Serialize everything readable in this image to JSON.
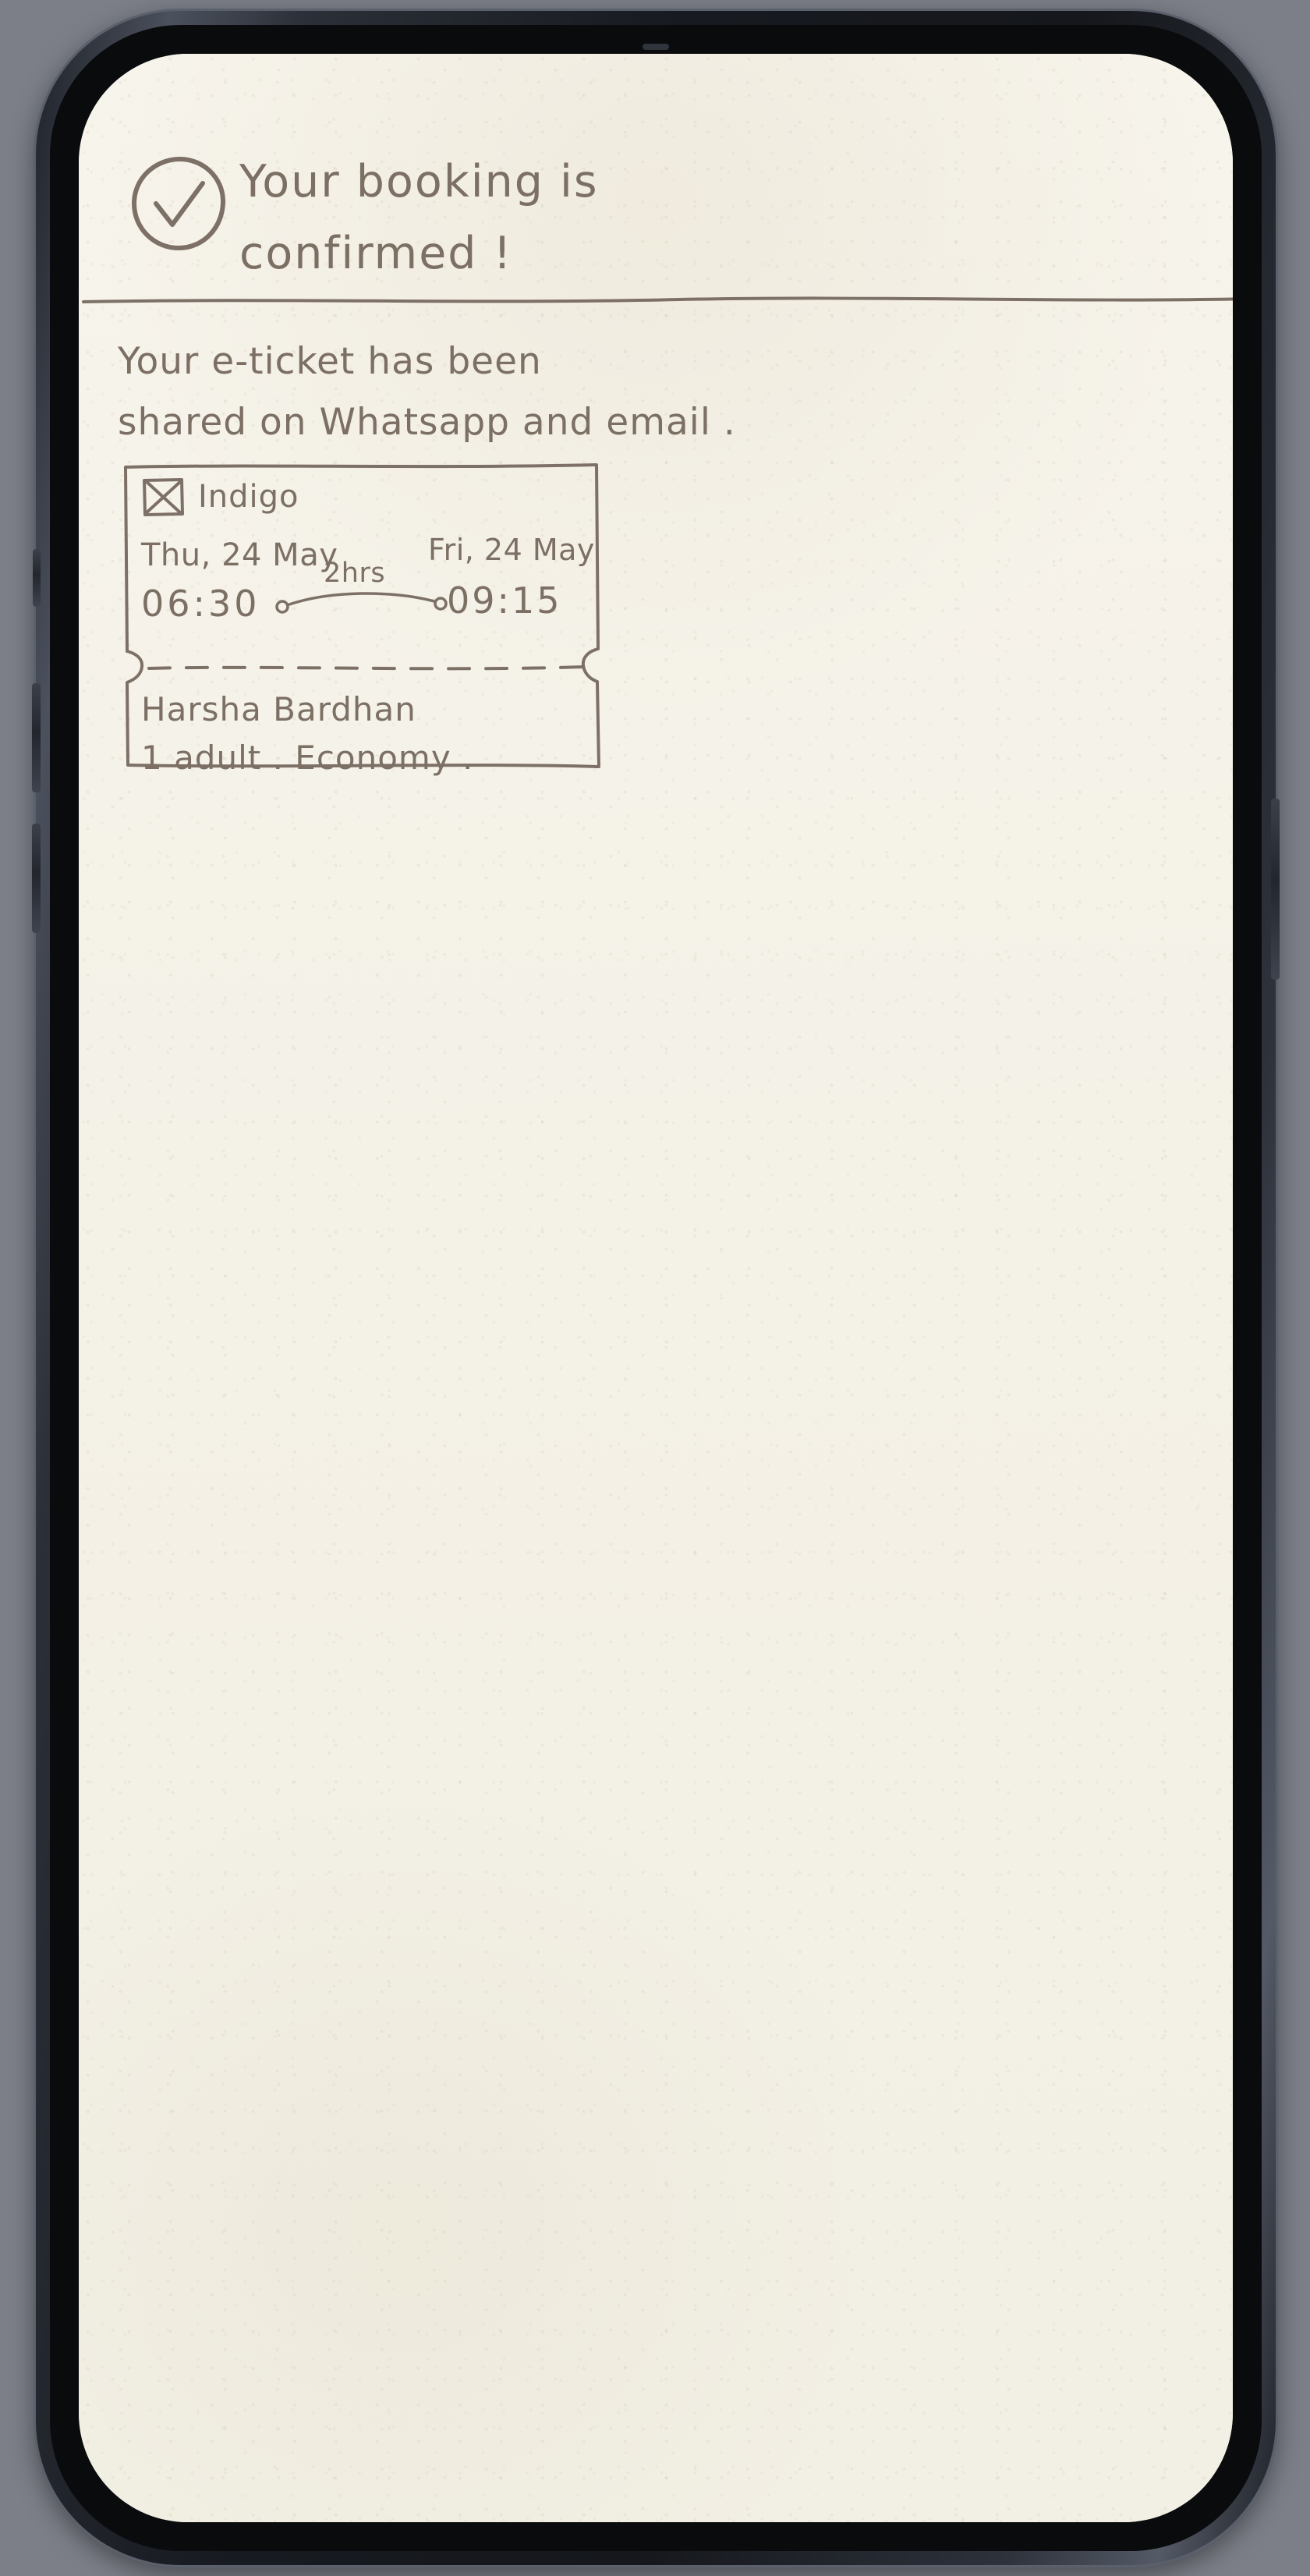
{
  "screen": {
    "background_color": "#f5f2e9",
    "ink_color": "#7d7066",
    "device_frame_color": "#23262d"
  },
  "header": {
    "status_icon": "check-circle-icon",
    "title_line_1": "Your booking is",
    "title_line_2": "confirmed !"
  },
  "subtitle": {
    "line_1": "Your e-ticket has been",
    "line_2": "shared on Whatsapp and email ."
  },
  "ticket": {
    "airline_logo_icon": "image-placeholder-icon",
    "airline_name": "Indigo",
    "departure": {
      "date": "Thu, 24 May",
      "time": "06:30"
    },
    "arrival": {
      "date": "Fri, 24 May",
      "time": "09:15"
    },
    "duration": "2hrs",
    "passenger_name": "Harsha Bardhan",
    "passenger_details": "1 adult .  Economy ."
  }
}
